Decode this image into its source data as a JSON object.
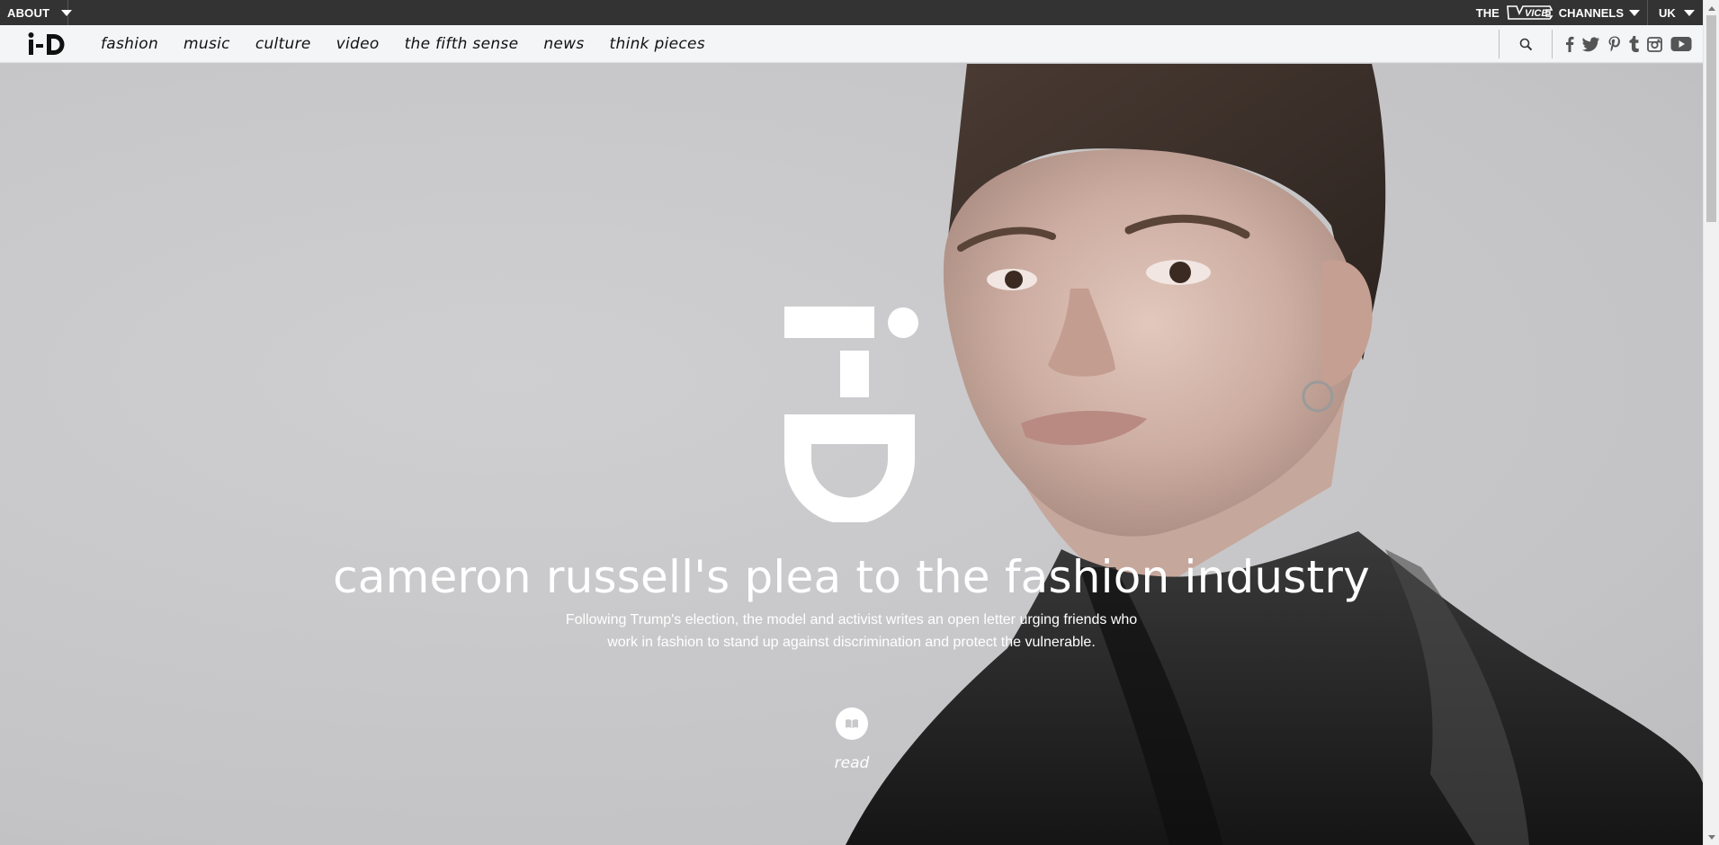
{
  "utility_bar": {
    "about_label": "ABOUT",
    "channels_prefix": "THE",
    "channels_brand": "VICE",
    "channels_suffix": "CHANNELS",
    "region_label": "UK"
  },
  "nav": {
    "brand": "i-D",
    "links": [
      "fashion",
      "music",
      "culture",
      "video",
      "the fifth sense",
      "news",
      "think pieces"
    ],
    "social_icons": [
      "facebook-icon",
      "twitter-icon",
      "pinterest-icon",
      "tumblr-icon",
      "instagram-icon",
      "youtube-icon"
    ]
  },
  "hero": {
    "headline": "cameron russell's plea to the fashion industry",
    "dek_line1": "Following Trump's election, the model and activist writes an open letter urging friends who",
    "dek_line2": "work in fashion to stand up against discrimination and protect the vulnerable.",
    "read_label": "read"
  },
  "colors": {
    "utility_bar": "#333333",
    "nav_background": "#f4f5f7",
    "hero_background": "#c9c9cb",
    "headline_text": "#ffffff"
  }
}
